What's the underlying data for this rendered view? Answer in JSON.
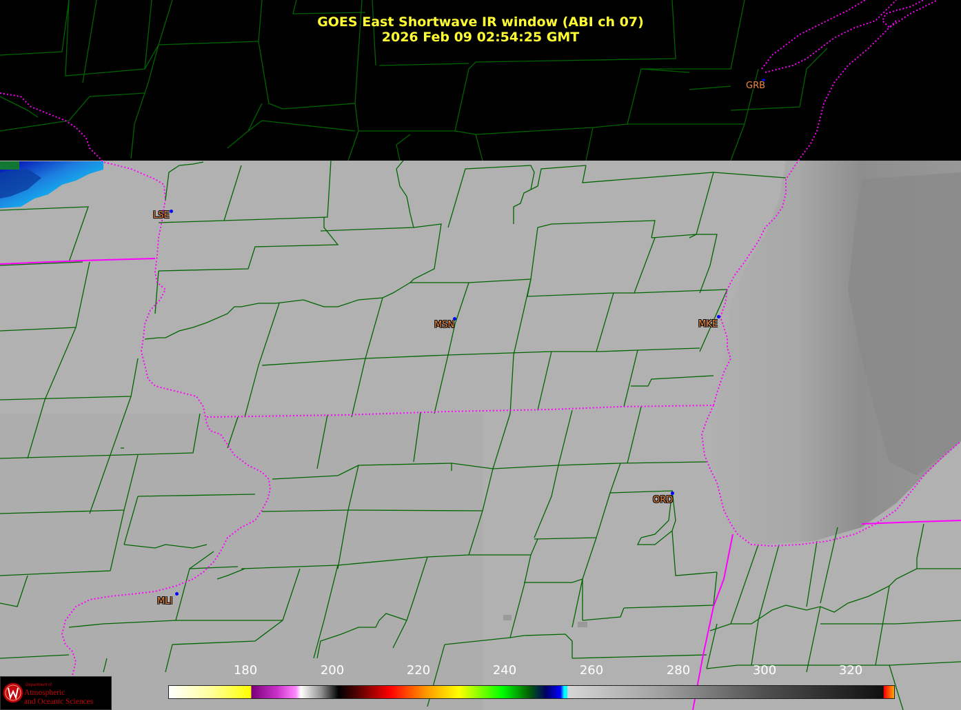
{
  "title": {
    "line1": "GOES East Shortwave IR window (ABI ch 07)",
    "line2": "2026 Feb 09  02:54:25 GMT"
  },
  "stations": [
    {
      "id": "GRB",
      "label": "GRB"
    },
    {
      "id": "LSE",
      "label": "LSE"
    },
    {
      "id": "MSN",
      "label": "MSN"
    },
    {
      "id": "MKE",
      "label": "MKE"
    },
    {
      "id": "ORD",
      "label": "ORD"
    },
    {
      "id": "MLI",
      "label": "MLI"
    }
  ],
  "colorbar": {
    "ticks": [
      "180",
      "200",
      "220",
      "240",
      "260",
      "280",
      "300",
      "320"
    ],
    "colors": {
      "low_white": "#ffffff",
      "yellow": "#ffff00",
      "magenta": "#cc33cc",
      "black": "#000000",
      "red": "#ff0000",
      "orange": "#ff9900",
      "green": "#00ff00",
      "navy": "#000066",
      "cyan": "#00ffff",
      "gray_light": "#d8d8d8",
      "gray_dark": "#101010"
    }
  },
  "map": {
    "county_line_color": "#006400",
    "state_line_color": "#ff00ff",
    "lake_michigan_color": "#8c8c8c",
    "cloud_top_color": "#7f7f7f",
    "land_color": "#b3b3b3"
  },
  "logo": {
    "dept": "Department of",
    "line1": "Atmospheric",
    "line2": "and Oceanic Sciences"
  }
}
